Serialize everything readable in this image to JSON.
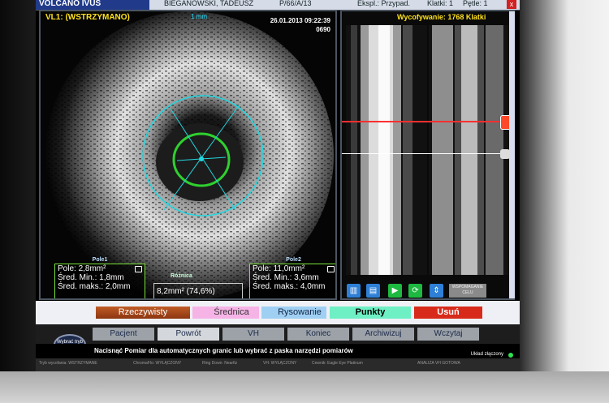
{
  "header": {
    "brand": "VOLCANO IVUS",
    "patient": "BIEGANOWSKI, TADEUSZ",
    "record_id": "P/66/A/13",
    "explorer": "Ekspl.: Przypad.",
    "frames": "Klatki: 1",
    "filled": "Pętle: 1",
    "close": "x"
  },
  "ivus": {
    "title": "VL1: (WSTRZYMANO)",
    "scale": "1 mm",
    "datetime": "26.01.2013 09:22:39",
    "frame_no": "0690"
  },
  "measurements": {
    "pole1": {
      "header": "Pole1",
      "area": "Pole: 2,8mm²",
      "min": "Śred. Min.: 1,8mm",
      "max": "Śred. maks.: 2,0mm"
    },
    "pole2": {
      "header": "Pole2",
      "area": "Pole: 11,0mm²",
      "min": "Śred. Min.: 3,6mm",
      "max": "Śred. maks.: 4,0mm"
    },
    "difference": {
      "header": "Różnica",
      "value": "8,2mm² (74,6%)"
    }
  },
  "longitudinal": {
    "title": "Wycofywanie: 1768 Klatki",
    "center_btn": "WSPOMAGANIE CELU"
  },
  "tools": {
    "rzeczywisty": "Rzeczywisty",
    "srednica": "Średnica",
    "rysowanie": "Rysowanie",
    "punkty": "Punkty",
    "usun": "Usuń"
  },
  "tabs": {
    "mode": "Wybrać tryb",
    "items": [
      "Pacjent",
      "Powrót",
      "VH",
      "Koniec",
      "Archiwizuj",
      "Wczytaj"
    ]
  },
  "message": "Nacisnąć Pomiar dla automatycznych granic lub wybrać z paska narzędzi pomiarów",
  "status": "Układ złączony",
  "footer": [
    "Tryb wycofania: WSTRZYMANE",
    "ChromaFlo: WYŁĄCZONY",
    "Ring Down: Nearfiz",
    "VH: WYŁĄCZONY",
    "Cewnik: Eagle Eye Platinum",
    "ANALIZA VH GOTOWA"
  ],
  "colors": {
    "title_yellow": "#ffe21a",
    "inner_contour": "#2fd02f",
    "outer_contour": "#22d7e0",
    "pullback_marker": "#ff3030"
  }
}
